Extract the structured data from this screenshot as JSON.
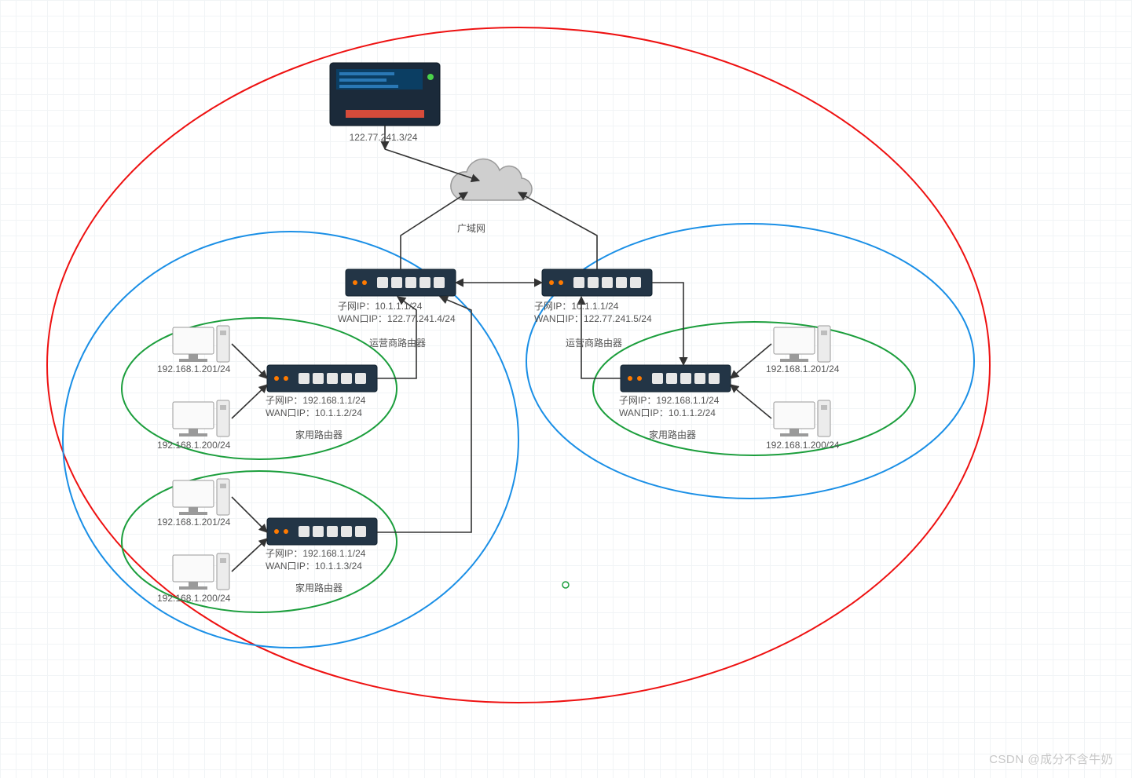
{
  "wan_label": "广域网",
  "server": {
    "ip": "122.77.241.3/24"
  },
  "isp_left": {
    "subnet": "子网IP：10.1.1.1/24",
    "wan": "WAN口IP：122.77.241.4/24",
    "name": "运营商路由器"
  },
  "isp_right": {
    "subnet": "子网IP：10.1.1.1/24",
    "wan": "WAN口IP：122.77.241.5/24",
    "name": "运营商路由器"
  },
  "home_a": {
    "subnet": "子网IP：192.168.1.1/24",
    "wan": "WAN口IP：10.1.1.2/24",
    "name": "家用路由器",
    "pc1": "192.168.1.201/24",
    "pc2": "192.168.1.200/24"
  },
  "home_b": {
    "subnet": "子网IP：192.168.1.1/24",
    "wan": "WAN口IP：10.1.1.3/24",
    "name": "家用路由器",
    "pc1": "192.168.1.201/24",
    "pc2": "192.168.1.200/24"
  },
  "home_c": {
    "subnet": "子网IP：192.168.1.1/24",
    "wan": "WAN口IP：10.1.1.2/24",
    "name": "家用路由器",
    "pc1": "192.168.1.201/24",
    "pc2": "192.168.1.200/24"
  },
  "watermark": "CSDN @成分不含牛奶"
}
